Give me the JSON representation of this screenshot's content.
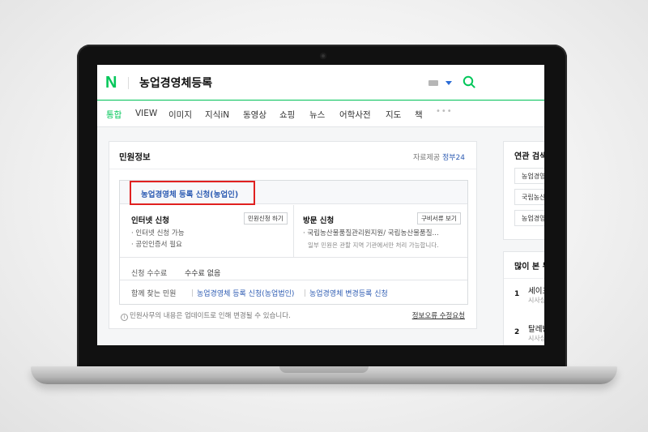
{
  "header": {
    "logo": "N",
    "query": "농업경영체등록"
  },
  "tabs": [
    "통합",
    "VIEW",
    "이미지",
    "지식iN",
    "동영상",
    "쇼핑",
    "뉴스",
    "어학사전",
    "지도",
    "책"
  ],
  "tabs_more": "•••",
  "colors": {
    "brand": "#03c75a",
    "link": "#2f5db3",
    "highlight_frame": "#e02020"
  },
  "card": {
    "title": "민원정보",
    "source_label": "자료제공",
    "source_link": "정부24",
    "service_title": "농업경영체 등록 신청(농업인)",
    "internet": {
      "title": "인터넷 신청",
      "button": "민원신청 하기",
      "items": [
        "· 인터넷 신청 가능",
        "· 공인인증서 필요"
      ]
    },
    "visit": {
      "title": "방문 신청",
      "button": "구비서류 보기",
      "items": [
        "· 국립농산물품질관리원지원/ 국립농산물품질..."
      ],
      "note": "일부 민원은 관할 지역 기관에서만 처리 가능합니다."
    },
    "fee_label": "신청 수수료",
    "fee_value": "수수료 없음",
    "related_label": "함께 찾는 민원",
    "related_links": [
      "농업경영체 등록 신청(농업법인)",
      "농업경영체 변경등록 신청"
    ],
    "footer_note": "민원사무의 내용은 업데이트로 인해 변경될 수 있습니다.",
    "report_link": "정보오류 수정요청"
  },
  "side": {
    "related_title": "연관 검색어",
    "related_chips": [
      "농업경영체",
      "국립농산물",
      "농업경영체"
    ],
    "popular_title": "많이 본 뉴스",
    "popular_items": [
      {
        "rank": "1",
        "title": "세이프",
        "sub": "시사상식"
      },
      {
        "rank": "2",
        "title": "탈레반",
        "sub": "시사상식"
      }
    ]
  }
}
